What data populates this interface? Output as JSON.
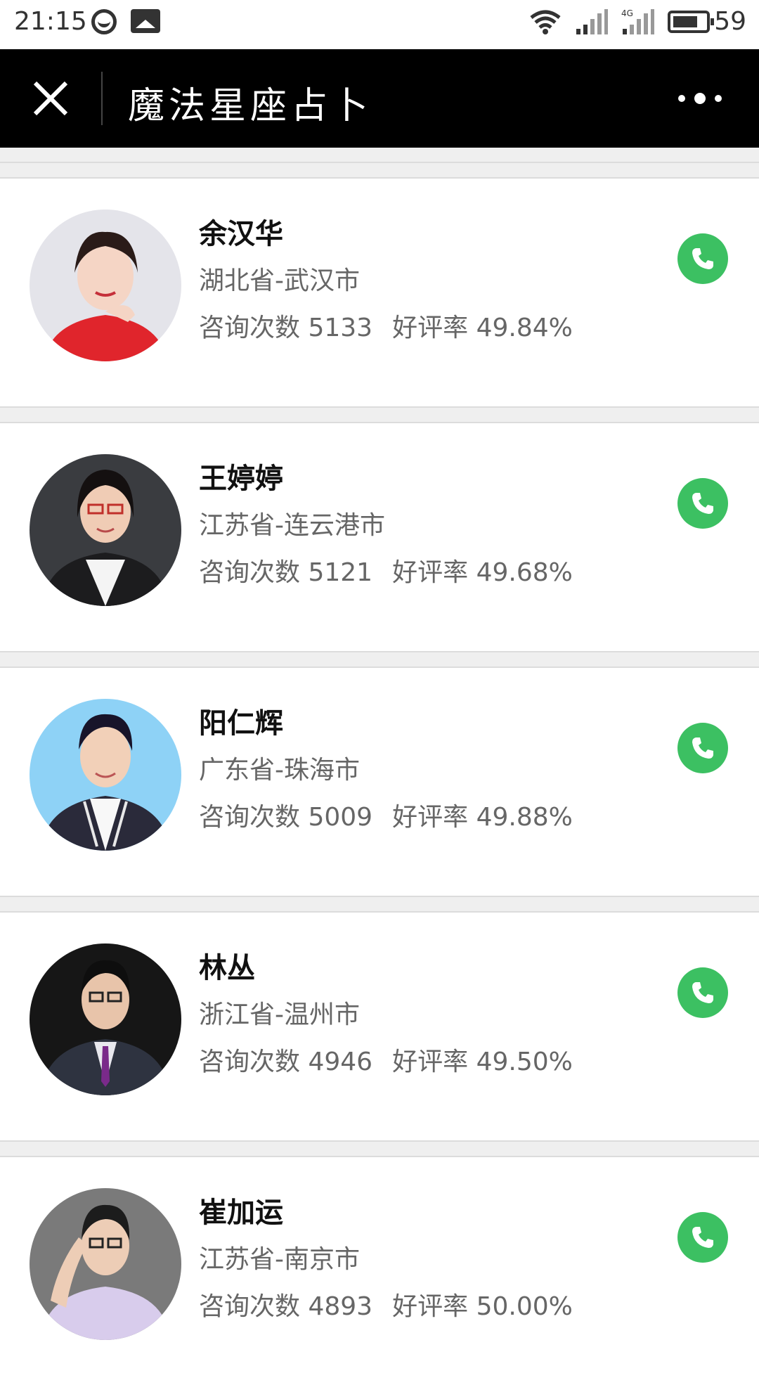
{
  "status_bar": {
    "time": "21:15",
    "network": "4G",
    "battery": "59",
    "icons": [
      "face-icon",
      "photo-icon",
      "wifi-icon",
      "signal-icon",
      "signal-4g-icon",
      "battery-icon"
    ]
  },
  "nav": {
    "title": "魔法星座占卜",
    "close_icon": "close-icon",
    "more_icon": "more-icon"
  },
  "colors": {
    "nav_bg": "#000000",
    "call_green": "#3cc062",
    "page_bg": "#efefef"
  },
  "labels": {
    "consult_prefix": "咨询次数",
    "rating_prefix": "好评率"
  },
  "experts": [
    {
      "name": "余汉华",
      "location": "湖北省-武汉市",
      "consult_label": "咨询次数",
      "consult_count": "5133",
      "rating_label": "好评率",
      "rating": "49.84%"
    },
    {
      "name": "王婷婷",
      "location": "江苏省-连云港市",
      "consult_label": "咨询次数",
      "consult_count": "5121",
      "rating_label": "好评率",
      "rating": "49.68%"
    },
    {
      "name": "阳仁辉",
      "location": "广东省-珠海市",
      "consult_label": "咨询次数",
      "consult_count": "5009",
      "rating_label": "好评率",
      "rating": "49.88%"
    },
    {
      "name": "林丛",
      "location": "浙江省-温州市",
      "consult_label": "咨询次数",
      "consult_count": "4946",
      "rating_label": "好评率",
      "rating": "49.50%"
    },
    {
      "name": "崔加运",
      "location": "江苏省-南京市",
      "consult_label": "咨询次数",
      "consult_count": "4893",
      "rating_label": "好评率",
      "rating": "50.00%"
    }
  ]
}
